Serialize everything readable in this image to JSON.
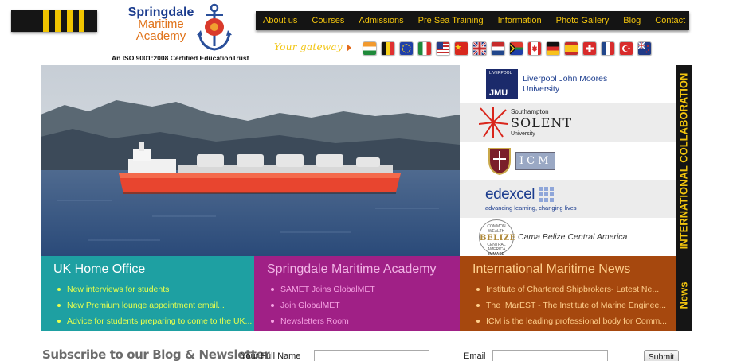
{
  "brand": {
    "name_line1": "Springdale",
    "name_line2": "Maritime",
    "name_line3": "Academy",
    "tagline": "An ISO 9001:2008 Certified EducationTrust"
  },
  "nav": {
    "items": [
      "About us",
      "Courses",
      "Admissions",
      "Pre Sea Training",
      "Information",
      "Photo Gallery",
      "Blog",
      "Contact"
    ]
  },
  "gateway": {
    "label": "Your gateway",
    "flags": [
      "india-flag",
      "belgium-flag",
      "eu-flag",
      "italy-flag",
      "usa-flag",
      "china-flag",
      "uk-flag",
      "netherlands-flag",
      "south-africa-flag",
      "canada-flag",
      "germany-flag",
      "spain-flag",
      "switzerland-flag",
      "france-flag",
      "turkey-flag",
      "new-zealand-flag"
    ]
  },
  "partners": {
    "vertical_label": "INTERNATIONAL COLLABORATION",
    "items": [
      {
        "abbr": "JMU",
        "name_line1": "Liverpool John Moores",
        "name_line2": "University",
        "small": "LIVERPOOL"
      },
      {
        "name_line1": "Southampton",
        "name_line2": "SOLENT",
        "name_line3": "University"
      },
      {
        "name": "ICM"
      },
      {
        "name": "edexcel",
        "tagline": "advancing learning, changing lives"
      },
      {
        "seal_word": "BELIZE",
        "seal_top": "COMMON WEALTH",
        "seal_mid": "CENTRAL AMERICA",
        "seal_bottom": "IMMASE",
        "name": "Cama Belize Central America"
      }
    ]
  },
  "news_label": "News",
  "boxes": [
    {
      "title": "UK Home Office",
      "items": [
        "New interviews for students",
        "New Premium lounge appointment email...",
        "Advice for students preparing to come to the UK..."
      ]
    },
    {
      "title": "Springdale Maritime Academy",
      "items": [
        "SAMET Joins GlobalMET",
        "Join GlobalMET",
        "Newsletters Room"
      ]
    },
    {
      "title": "International Maritime News",
      "items": [
        "Institute of Chartered Shipbrokers- Latest Ne...",
        "The IMarEST - The Institute of Marine Enginee...",
        "ICM is the leading professional body for Comm..."
      ]
    }
  ],
  "subscribe": {
    "title": "Subscribe to our Blog & Newsletter",
    "name_label": "Your Full Name",
    "name_value": "",
    "email_label": "Email",
    "email_value": "",
    "submit_label": "Submit"
  },
  "colors": {
    "nav_text": "#f2c40e",
    "teal": "#1ea0a2",
    "magenta": "#a02086",
    "rust": "#a6480e",
    "ship_hull": "#e8452f"
  }
}
